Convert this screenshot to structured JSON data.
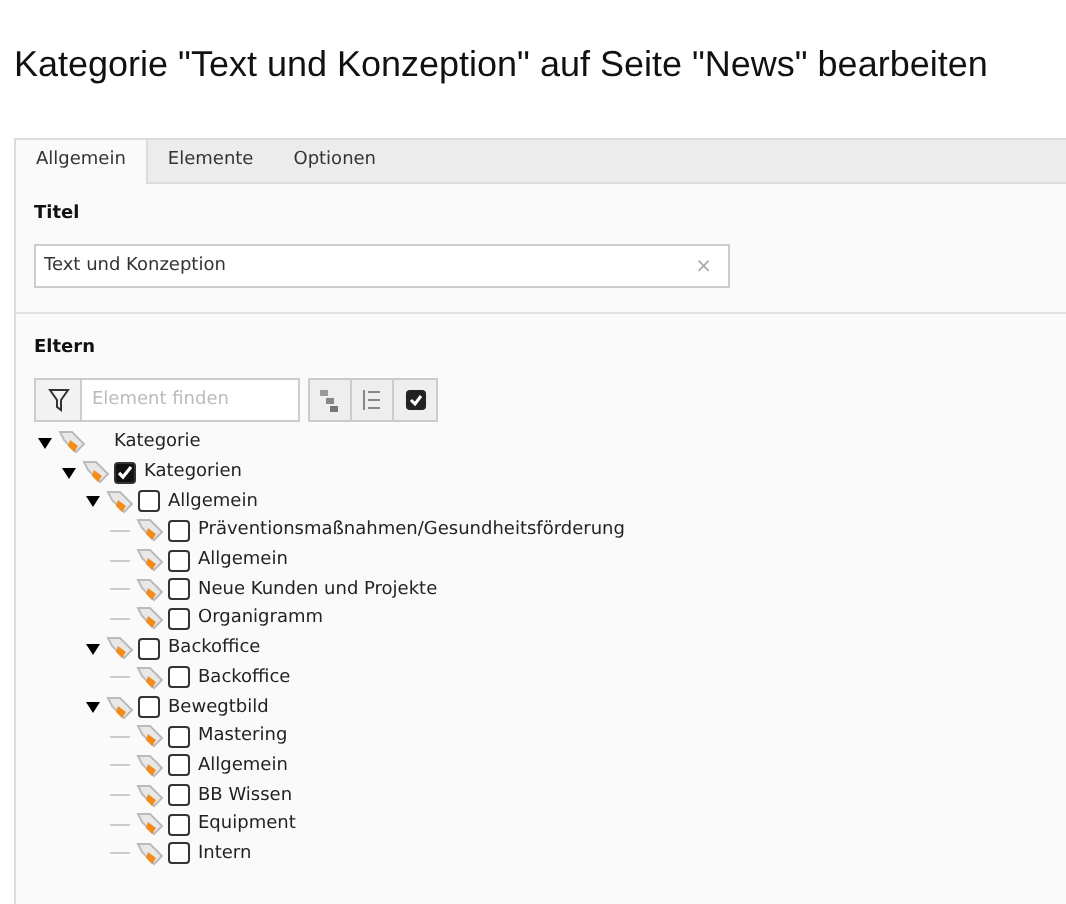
{
  "heading": "Kategorie \"Text und Konzeption\" auf Seite \"News\" bearbeiten",
  "tabs": [
    {
      "label": "Allgemein",
      "selected": true
    },
    {
      "label": "Elemente",
      "selected": false
    },
    {
      "label": "Optionen",
      "selected": false
    }
  ],
  "title_field": {
    "label": "Titel",
    "value": "Text und Konzeption",
    "clear": "×"
  },
  "parents": {
    "label": "Eltern",
    "search": {
      "placeholder": "Element finden"
    },
    "tree": [
      {
        "kind": "root",
        "label": "Kategorie",
        "expanded": true,
        "children": [
          {
            "kind": "category",
            "label": "Kategorien",
            "checked": true,
            "expanded": true,
            "children": [
              {
                "kind": "category",
                "label": "Allgemein",
                "checked": false,
                "expanded": true,
                "children": [
                  {
                    "kind": "category",
                    "label": "Präventionsmaßnahmen/Gesundheitsförderung",
                    "checked": false
                  },
                  {
                    "kind": "category",
                    "label": "Allgemein",
                    "checked": false
                  },
                  {
                    "kind": "category",
                    "label": "Neue Kunden und Projekte",
                    "checked": false
                  },
                  {
                    "kind": "category",
                    "label": "Organigramm",
                    "checked": false
                  }
                ]
              },
              {
                "kind": "category",
                "label": "Backoffice",
                "checked": false,
                "expanded": true,
                "children": [
                  {
                    "kind": "category",
                    "label": "Backoffice",
                    "checked": false
                  }
                ]
              },
              {
                "kind": "category",
                "label": "Bewegtbild",
                "checked": false,
                "expanded": true,
                "children": [
                  {
                    "kind": "category",
                    "label": "Mastering",
                    "checked": false
                  },
                  {
                    "kind": "category",
                    "label": "Allgemein",
                    "checked": false
                  },
                  {
                    "kind": "category",
                    "label": "BB Wissen",
                    "checked": false
                  },
                  {
                    "kind": "category",
                    "label": "Equipment",
                    "checked": false
                  },
                  {
                    "kind": "category",
                    "label": "Intern",
                    "checked": false
                  }
                ]
              }
            ]
          }
        ]
      }
    ]
  }
}
